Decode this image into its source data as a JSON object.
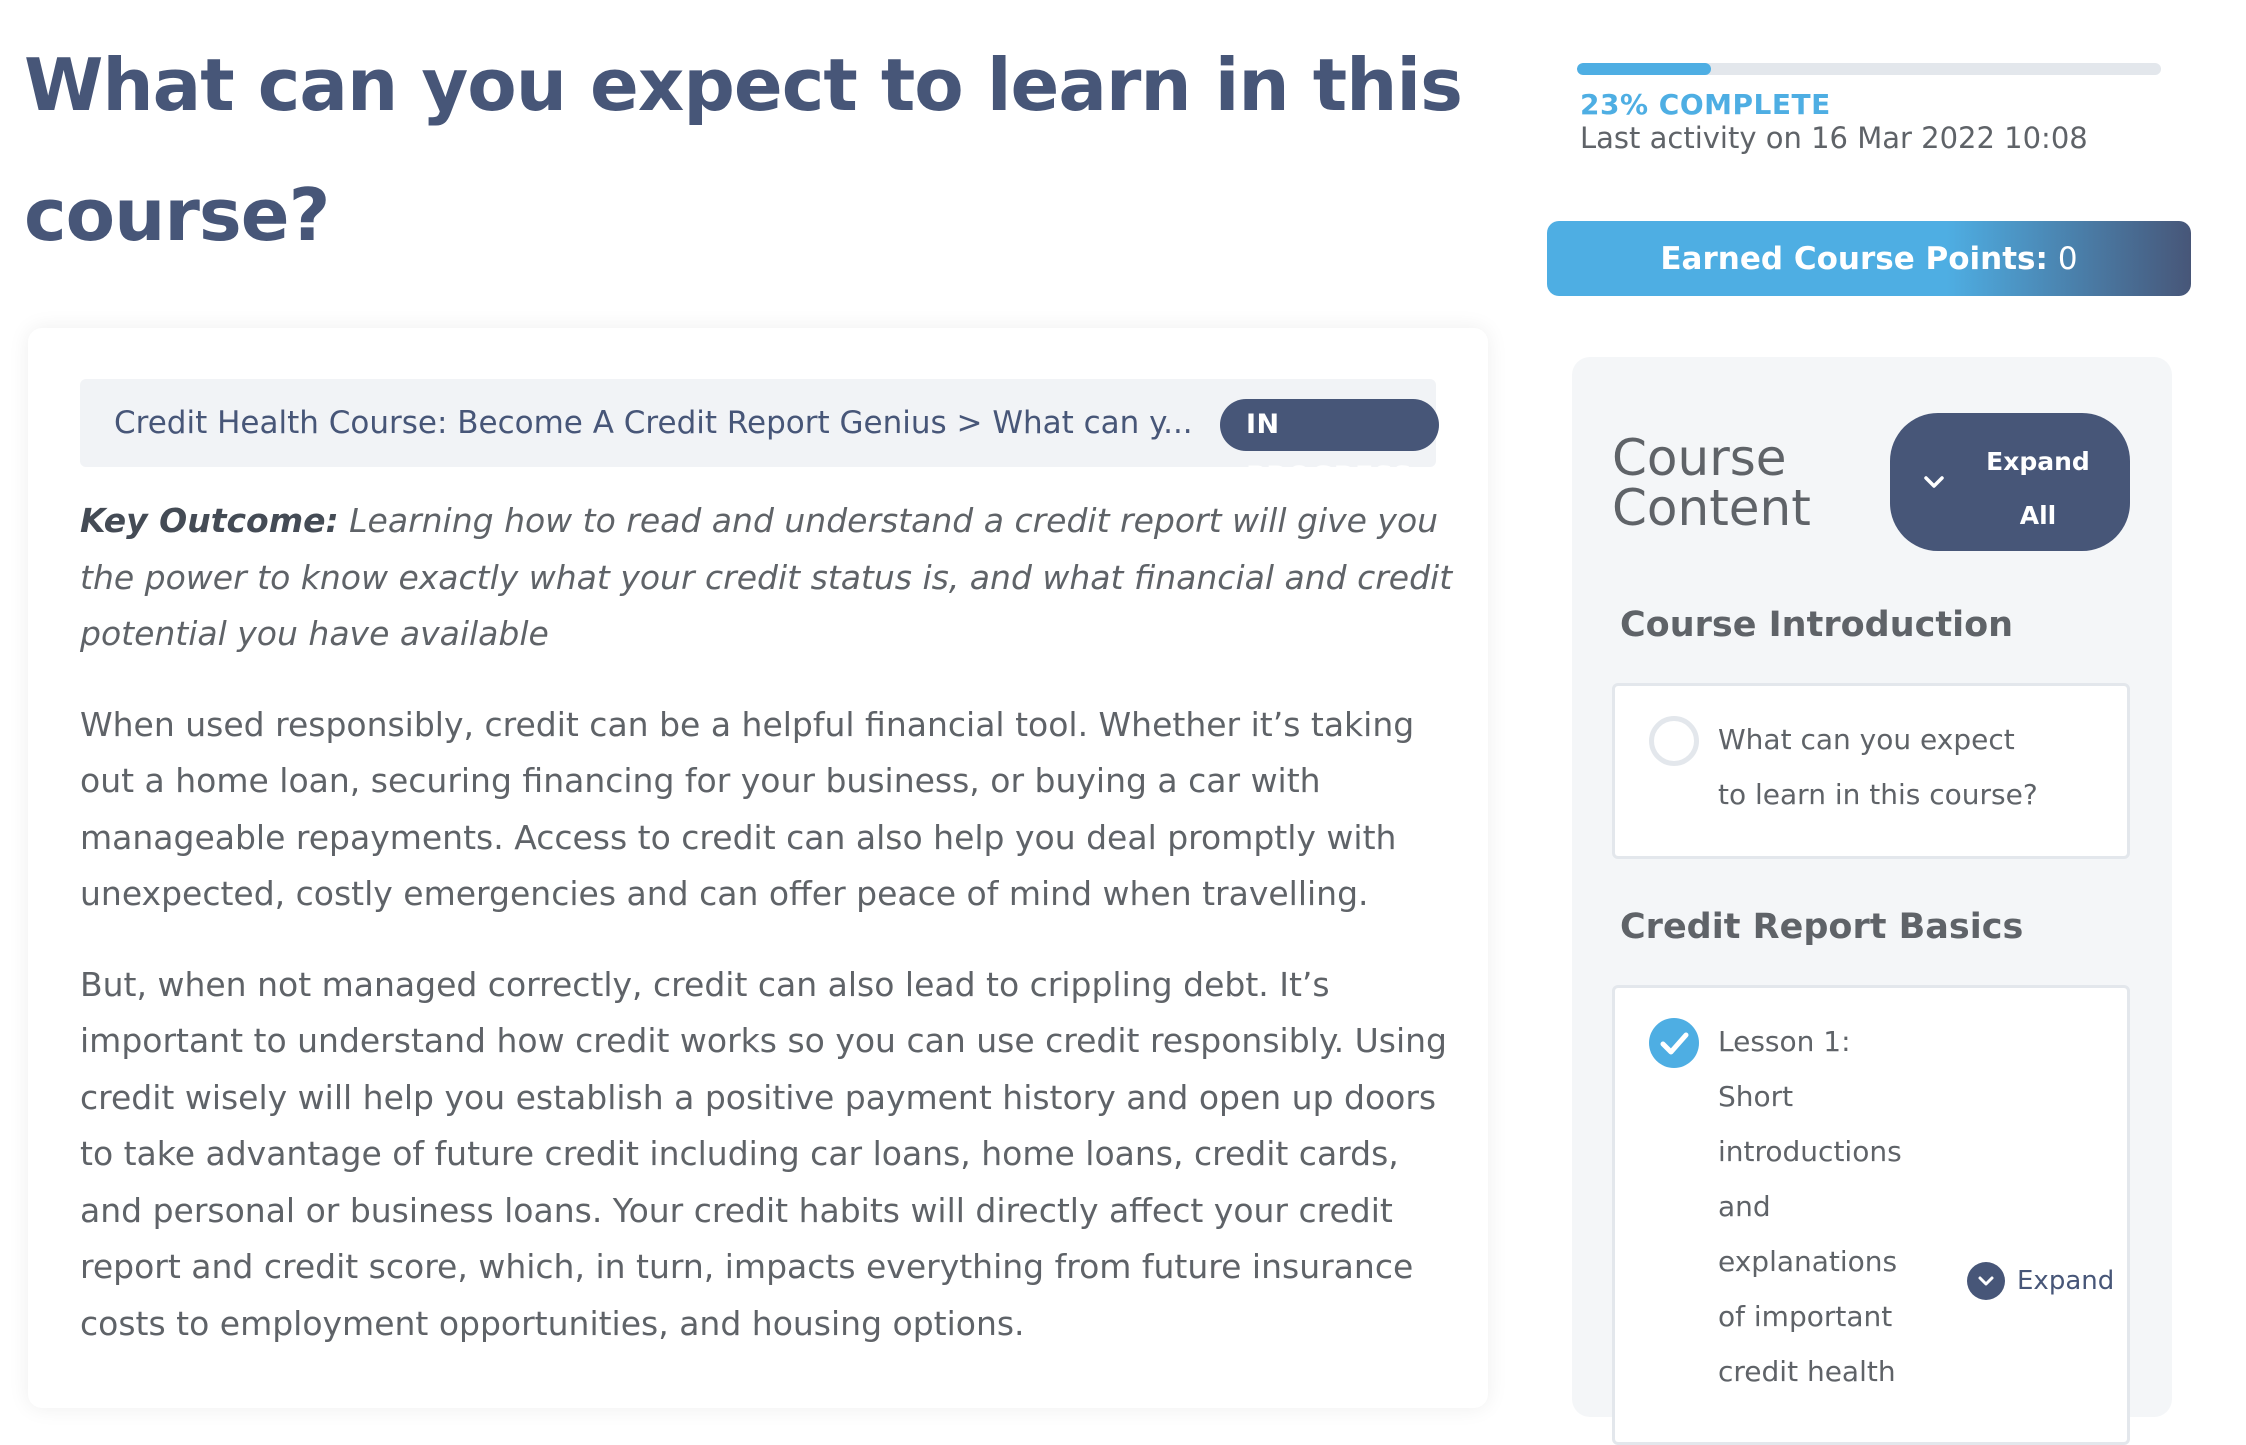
{
  "page": {
    "title": "What can you expect to learn in this course?"
  },
  "progress": {
    "percent": 23,
    "label": "23% COMPLETE",
    "last_activity": "Last activity on 16 Mar 2022 10:08"
  },
  "points": {
    "label": "Earned Course Points:",
    "value": "0"
  },
  "breadcrumb": {
    "text": "Credit Health Course: Become A Credit Report Genius > What can y...",
    "status": "IN PROGRESS"
  },
  "content": {
    "key_outcome_label": "Key Outcome:",
    "key_outcome_text": " Learning how to read and understand a credit report will give you the power to know exactly what your credit status is, and what financial and credit potential you have available",
    "paragraph_1": "When used responsibly, credit can be a helpful financial tool. Whether it’s taking out a home loan, securing financing for your business, or buying a car with manageable repayments. Access to credit can also help you deal promptly with unexpected, costly emergencies and can offer peace of mind when travelling.",
    "paragraph_2": "But, when not managed correctly, credit can also lead to crippling debt. It’s important to understand how credit works so you can use credit responsibly. Using credit wisely will help you establish a positive payment history and open up doors to take advantage of future credit including car loans, home loans, credit cards, and personal or business loans. Your credit habits will directly affect your credit report and credit score, which, in turn, impacts everything from future insurance costs to employment opportunities, and housing options."
  },
  "sidebar": {
    "title": "Course Content",
    "expand_all_line1": "Expand",
    "expand_all_line2": "All",
    "sections": [
      {
        "heading": "Course Introduction",
        "lessons": [
          {
            "title": "What can you expect to learn in this course?",
            "completed": false
          }
        ]
      },
      {
        "heading": "Credit Report Basics",
        "lessons": [
          {
            "title": "Lesson 1: Short introductions and explanations of important credit health",
            "completed": true,
            "expand_label": "Expand"
          }
        ]
      }
    ]
  },
  "colors": {
    "heading": "#475678",
    "accent": "#4eaee3",
    "text": "#5f6368",
    "badge_bg": "#475678"
  },
  "icons": {
    "expand_all": "chevron-down-icon",
    "lesson_incomplete": "empty-circle-icon",
    "lesson_complete": "check-circle-icon",
    "lesson_expand": "chevron-down-circle-icon"
  }
}
